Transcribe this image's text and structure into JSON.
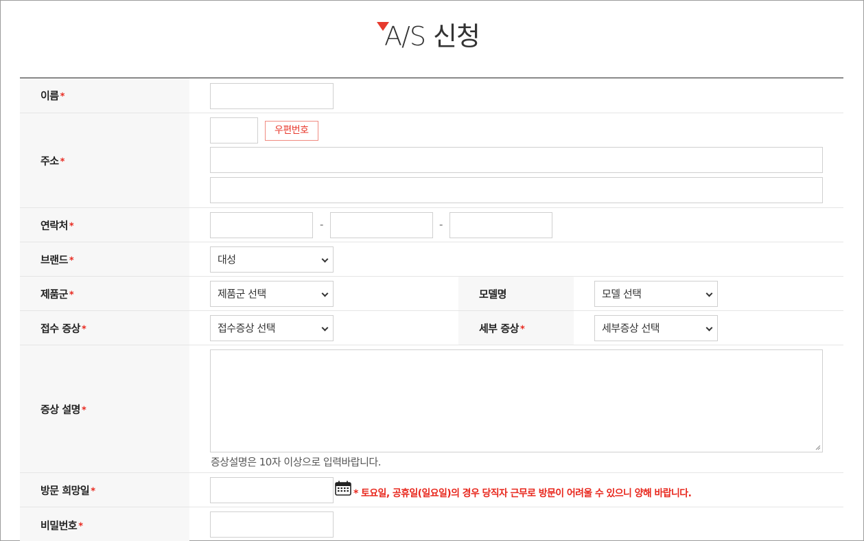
{
  "page": {
    "title": "A/S 신청",
    "accent_color": "#e63a2e"
  },
  "form": {
    "required_mark": "*",
    "name": {
      "label": "이름"
    },
    "address": {
      "label": "주소",
      "zip_button": "우편번호"
    },
    "phone": {
      "label": "연락처",
      "separator": "-"
    },
    "brand": {
      "label": "브랜드",
      "selected": "대성"
    },
    "product_group": {
      "label": "제품군",
      "selected": "제품군 선택"
    },
    "model": {
      "label": "모델명",
      "selected": "모델 선택"
    },
    "symptom": {
      "label": "접수 증상",
      "selected": "접수증상 선택"
    },
    "detail_symptom": {
      "label": "세부 증상",
      "selected": "세부증상 선택"
    },
    "description": {
      "label": "증상 설명",
      "hint": "증상설명은 10자 이상으로 입력바랍니다."
    },
    "visit_date": {
      "label": "방문 희망일",
      "notice": "* 토요일, 공휴일(일요일)의 경우 당직자 근무로 방문이 어려울 수 있으니 양해 바랍니다.",
      "icon": "calendar-icon"
    },
    "password": {
      "label": "비밀번호"
    }
  }
}
